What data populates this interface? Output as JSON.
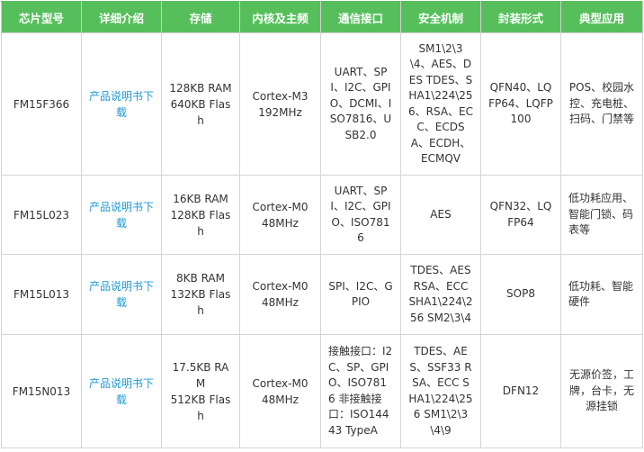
{
  "headers": {
    "chip_model": "芯片型号",
    "details": "详细介绍",
    "storage": "存储",
    "core_freq": "内核及主频",
    "interface": "通信接口",
    "security": "安全机制",
    "package": "封装形式",
    "application": "典型应用"
  },
  "rows": [
    {
      "model": "FM15F366",
      "link": "产品说明书下载",
      "ram": "128KB RAM",
      "flash": "640KB Flash",
      "core": "Cortex-M3",
      "freq": "192MHz",
      "interface": "UART、SPI、I2C、GPIO、DCMI、ISO7816、USB2.0",
      "security": "SM1\\2\\3\\4、AES、DES TDES、SHA1\\224\\256、RSA、ECC、ECDSA、ECDH、ECMQV",
      "package": "QFN40、LQFP64、LQFP100",
      "application": "POS、校园水控、充电桩、扫码、门禁等"
    },
    {
      "model": "FM15L023",
      "link": "产品说明书下载",
      "ram": "16KB RAM",
      "flash": "128KB Flash",
      "core": "Cortex-M0",
      "freq": "48MHz",
      "interface": "UART、SPI、I2C、GPIO、ISO7816",
      "security": "AES",
      "package": "QFN32、LQFP64",
      "application": "低功耗应用、智能门锁、码表等"
    },
    {
      "model": "FM15L013",
      "link": "产品说明书下载",
      "ram": "8KB RAM",
      "flash": "132KB Flash",
      "core": "Cortex-M0",
      "freq": "48MHz",
      "interface": "SPI、I2C、GPIO",
      "security": "TDES、AES RSA、ECC SHA1\\224\\256 SM2\\3\\4",
      "package": "SOP8",
      "application": "低功耗、智能硬件"
    },
    {
      "model": "FM15N013",
      "link": "产品说明书下载",
      "ram": "17.5KB RAM",
      "flash": "512KB Flash",
      "core": "Cortex-M0",
      "freq": "48MHz",
      "interface": "接触接口：I2C、SP、GPIO、ISO7816 非接触接口：ISO14443 TypeA",
      "security": "TDES、AES、SSF33 RSA、ECC SHA1\\224\\256 SM1\\2\\3\\4\\9",
      "package": "DFN12",
      "application": "无源价签，工牌，台卡，无源挂锁"
    }
  ],
  "colors": {
    "header_bg": "#56bf5b",
    "header_text": "#ffffff",
    "link": "#1e9ad6",
    "body_text": "#333333",
    "border": "#d4d4d4"
  }
}
